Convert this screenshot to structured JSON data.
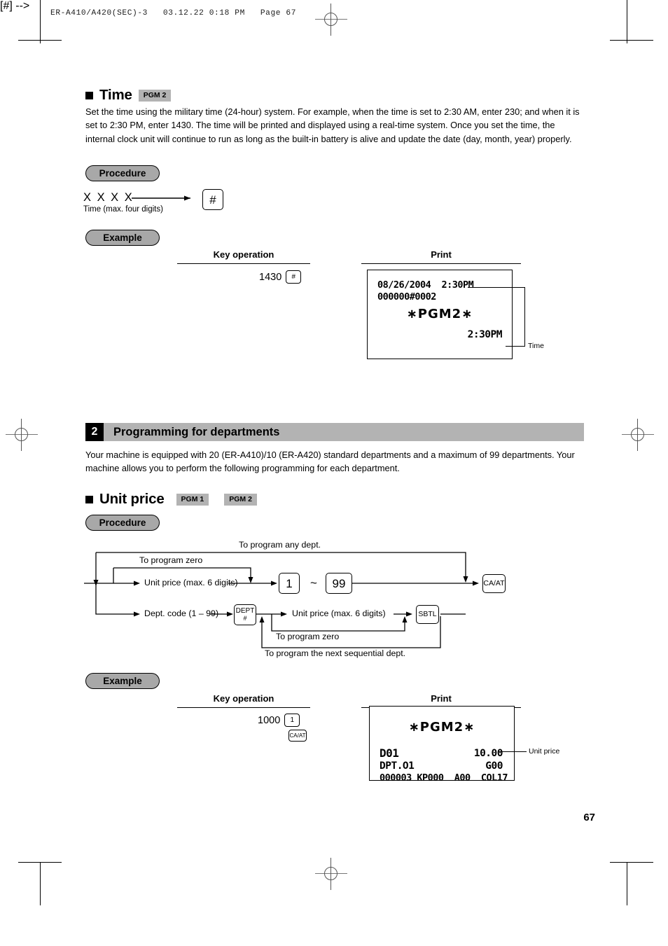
{
  "document": {
    "file_header": "ER-A410/A420(SEC)-3   03.12.22 0:18 PM   Page 67",
    "page_number": "67"
  },
  "time_section": {
    "heading": "Time",
    "badge": "PGM 2",
    "body": "Set the time using the military time (24-hour) system. For example, when the time is set to 2:30 AM, enter 230; and when it is set to 2:30 PM, enter 1430. The time will be printed and displayed using a real-time system. Once you set the time, the internal clock unit will continue to run as long as the built-in battery is alive and update the date (day, month, year) properly.",
    "procedure_pill": "Procedure",
    "procedure": {
      "input_glyph": "X X X X",
      "input_caption": "Time (max. four digits)",
      "key": "#"
    },
    "example_pill": "Example",
    "key_operation_caption": "Key operation",
    "print_caption": "Print",
    "key_operation": {
      "entry": "1430",
      "key": "#"
    },
    "receipt": {
      "line1": "08/26/2004  2:30PM",
      "line2": "000000#0002",
      "center": "∗PGM2∗",
      "line3": "2:30PM"
    },
    "callout": "Time"
  },
  "dept_section": {
    "banner_number": "2",
    "banner_title": "Programming for departments",
    "body": "Your machine is equipped with 20 (ER-A410)/10 (ER-A420) standard departments and a maximum of 99 departments. Your machine allows you to perform the following programming for each department.",
    "heading": "Unit price",
    "badge1": "PGM 1",
    "badge2": "PGM 2",
    "procedure_pill": "Procedure",
    "flow": {
      "label_any_dept": "To program any dept.",
      "label_zero_top": "To program zero",
      "label_unit_price_top": "Unit price (max. 6 digits)",
      "key_1": "1",
      "tilde": "~",
      "key_99": "99",
      "key_caat": "CA/AT",
      "label_dept_code": "Dept. code (1 – 99)",
      "key_dept_line1": "DEPT",
      "key_dept_line2": "#",
      "label_unit_price_bottom": "Unit price (max. 6 digits)",
      "key_sbtl": "SBTL",
      "label_zero_bottom": "To program zero",
      "label_next_dept": "To program the next sequential dept."
    },
    "example_pill": "Example",
    "key_operation_caption": "Key operation",
    "print_caption": "Print",
    "key_operation": {
      "entry": "1000",
      "key1": "1",
      "key2": "CA/AT"
    },
    "receipt": {
      "center": "∗PGM2∗",
      "line1_left": "D01",
      "line1_right": "10.00",
      "line2_left": "DPT.O1",
      "line2_right": "G00",
      "line3": "000003 KP000  A00  COL17"
    },
    "callout": "Unit price"
  }
}
